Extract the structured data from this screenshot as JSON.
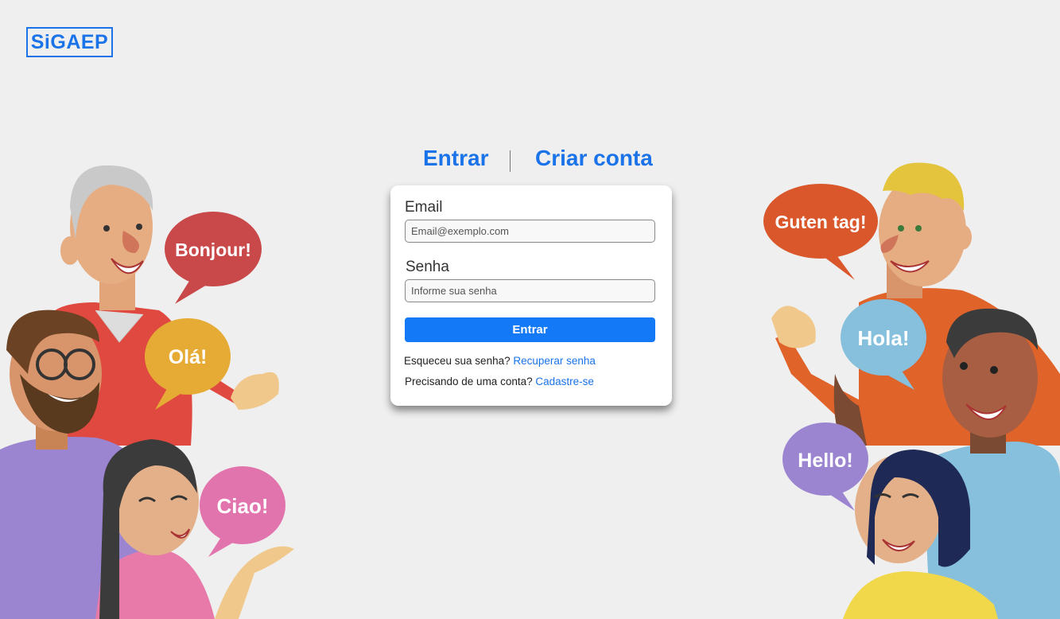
{
  "brand": {
    "logo_text": "SiGAEP"
  },
  "tabs": {
    "login_label": "Entrar",
    "signup_label": "Criar conta"
  },
  "form": {
    "email_label": "Email",
    "email_placeholder": "Email@exemplo.com",
    "password_label": "Senha",
    "password_placeholder": "Informe sua senha",
    "submit_label": "Entrar",
    "forgot_text": "Esqueceu sua senha?",
    "forgot_link": "Recuperar senha",
    "signup_text": "Precisando de uma conta?",
    "signup_link": "Cadastre-se"
  },
  "greetings": {
    "bonjour": "Bonjour!",
    "ola": "Olá!",
    "ciao": "Ciao!",
    "guten": "Guten tag!",
    "hola": "Hola!",
    "hello": "Hello!"
  },
  "colors": {
    "accent": "#1a73e8",
    "button": "#1479f7",
    "background": "#efefef"
  }
}
